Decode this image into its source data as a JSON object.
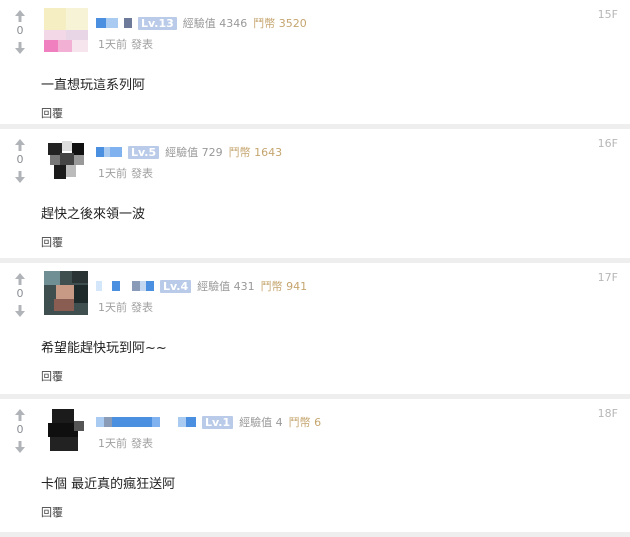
{
  "comments": [
    {
      "floor": "15F",
      "vote_count": "0",
      "level": "Lv.13",
      "exp_label": "經驗值 4346",
      "coin_label": "鬥幣 3520",
      "time": "1天前",
      "post_label": "發表",
      "text": "一直想玩這系列阿",
      "reply": "回覆"
    },
    {
      "floor": "16F",
      "vote_count": "0",
      "level": "Lv.5",
      "exp_label": "經驗值 729",
      "coin_label": "鬥幣 1643",
      "time": "1天前",
      "post_label": "發表",
      "text": "趕快之後來領一波",
      "reply": "回覆"
    },
    {
      "floor": "17F",
      "vote_count": "0",
      "level": "Lv.4",
      "exp_label": "經驗值 431",
      "coin_label": "鬥幣 941",
      "time": "1天前",
      "post_label": "發表",
      "text": "希望能趕快玩到阿~~",
      "reply": "回覆"
    },
    {
      "floor": "18F",
      "vote_count": "0",
      "level": "Lv.1",
      "exp_label": "經驗值 4",
      "coin_label": "鬥幣 6",
      "time": "1天前",
      "post_label": "發表",
      "text": "卡個 最近真的瘋狂送阿",
      "reply": "回覆"
    }
  ],
  "colors": {
    "level_badge": "#b9cbe8",
    "coin_text": "#c5a56f",
    "separator": "#eeeeee"
  },
  "icons": {
    "upvote": "arrow-up-icon",
    "downvote": "arrow-down-icon"
  }
}
